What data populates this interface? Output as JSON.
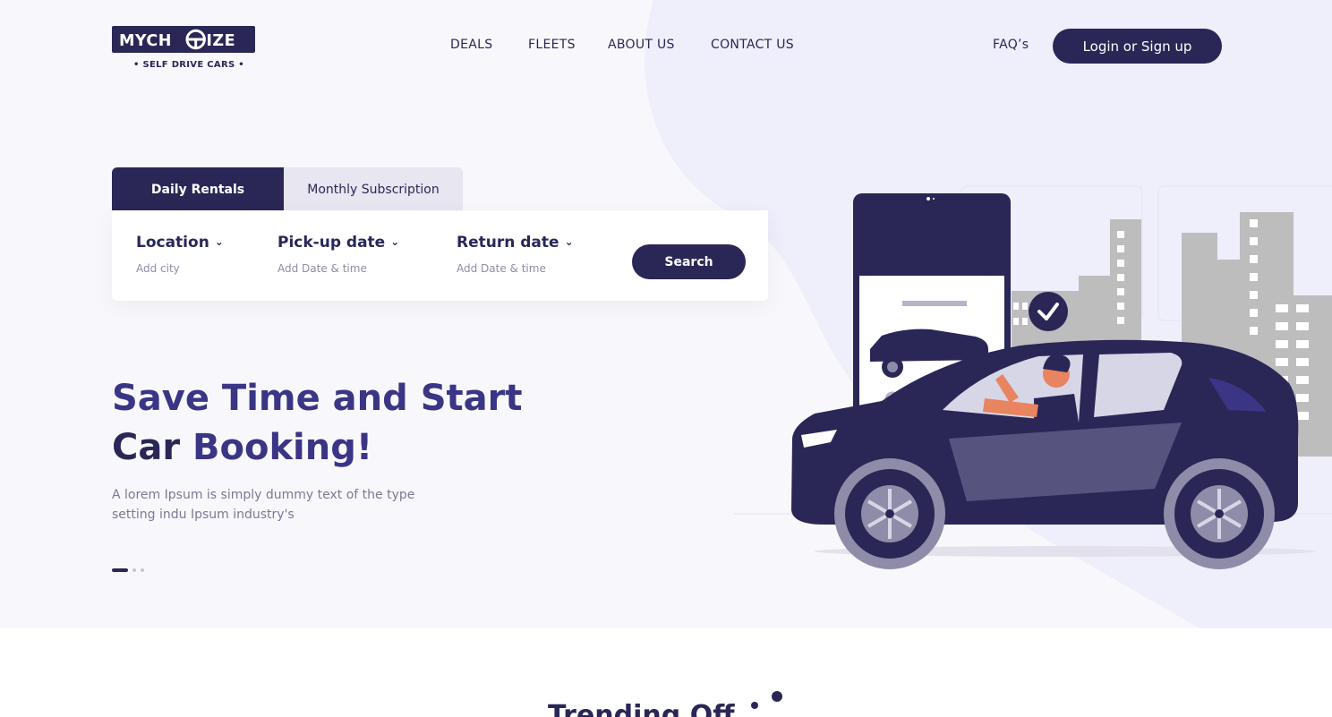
{
  "header": {
    "logo_text": "MYCHOIZE",
    "logo_tagline": "• SELF DRIVE CARS •",
    "nav": [
      "DEALS",
      "FLEETS",
      "ABOUT US",
      "CONTACT US"
    ],
    "faq_label": "FAQ’s",
    "login_label": "Login or  Sign up"
  },
  "booking": {
    "tabs": [
      "Daily Rentals",
      "Monthly Subscription"
    ],
    "active_tab": "Daily Rentals",
    "fields": [
      {
        "label": "Location",
        "placeholder": "Add city"
      },
      {
        "label": "Pick-up date",
        "placeholder": "Add Date & time"
      },
      {
        "label": "Return date",
        "placeholder": "Add Date & time"
      }
    ],
    "search_label": "Search"
  },
  "hero": {
    "headline_line1": "Save Time and Start",
    "headline_line2_a": "Car ",
    "headline_line2_b": "Booking!",
    "subtext": "A lorem Ipsum is simply dummy text of the type setting indu Ipsum industry's",
    "carousel_count": 3,
    "carousel_active": 1
  },
  "section": {
    "title_partial": "Trending Off"
  },
  "colors": {
    "primary": "#2a2757",
    "accent": "#3a3585",
    "hero_bg": "#f8f8fc",
    "blob": "#eeedfa",
    "muted_text": "#7b7993"
  }
}
